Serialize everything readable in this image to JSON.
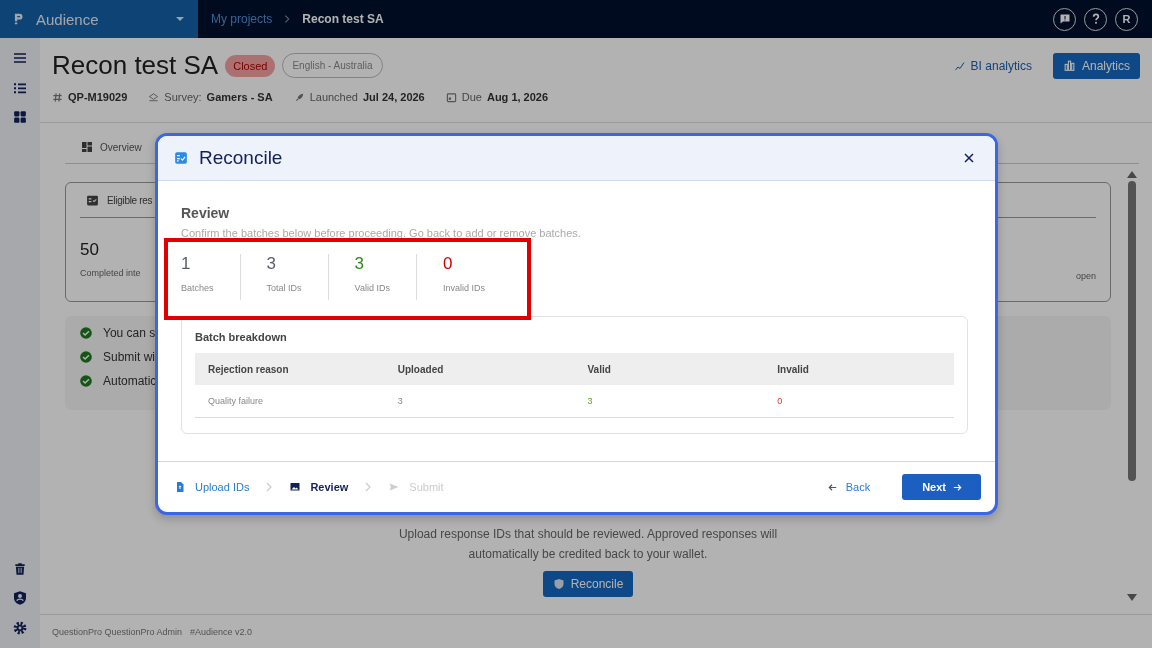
{
  "app": {
    "name": "Audience",
    "avatar": "R"
  },
  "breadcrumb": [
    {
      "label": "My projects",
      "selected": false
    },
    {
      "label": "Recon test SA",
      "selected": true
    }
  ],
  "project": {
    "title": "Recon test SA",
    "status": "Closed",
    "language": "English - Australia",
    "id": "QP-M19029",
    "survey_label": "Survey:",
    "survey": "Gamers - SA",
    "launched_label": "Launched",
    "launched": "Jul 24, 2026",
    "due_label": "Due",
    "due": "Aug 1, 2026"
  },
  "top_actions": {
    "bi": "BI analytics",
    "analytics": "Analytics"
  },
  "tabs": [
    {
      "label": "Overview",
      "selected": false
    }
  ],
  "summary_card": {
    "title": "Eligible res",
    "value": "50",
    "caption": "Completed inte",
    "right_caption": "open"
  },
  "checklist": [
    "You can s",
    "Submit wi",
    "Automatic"
  ],
  "reconcile_section": {
    "description": "Upload response IDs that should be reviewed. Approved responses will automatically be credited back to your wallet.",
    "button": "Reconcile"
  },
  "footer": {
    "text": "QuestionPro QuestionPro Admin",
    "version": "#Audience v2.0"
  },
  "modal": {
    "title": "Reconcile",
    "heading": "Review",
    "subtitle": "Confirm the batches below before proceeding. Go back to add or remove batches.",
    "stats": [
      {
        "value": "1",
        "label": "Batches",
        "color": "#5a5f66"
      },
      {
        "value": "3",
        "label": "Total IDs",
        "color": "#5a5f66"
      },
      {
        "value": "3",
        "label": "Valid IDs",
        "color": "#2f8a1c"
      },
      {
        "value": "0",
        "label": "Invalid IDs",
        "color": "#d40000"
      }
    ],
    "breakdown": {
      "title": "Batch breakdown",
      "columns": [
        "Rejection reason",
        "Uploaded",
        "Valid",
        "Invalid"
      ],
      "rows": [
        {
          "cells": [
            "Quality failure",
            "3",
            "3",
            "0"
          ]
        }
      ]
    },
    "steps": [
      {
        "label": "Upload IDs",
        "kind": "done"
      },
      {
        "label": "Review",
        "kind": "current"
      },
      {
        "label": "Submit",
        "kind": "pending"
      }
    ],
    "back": "Back",
    "next": "Next"
  }
}
